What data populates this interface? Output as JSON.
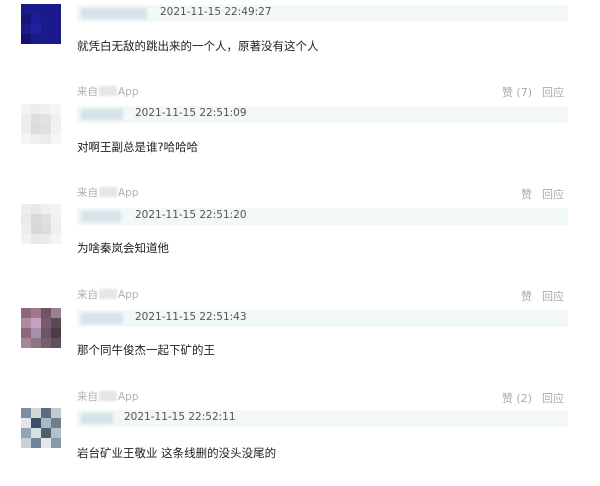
{
  "comments": [
    {
      "source_prefix": "",
      "source_suffix": "",
      "like_label": "",
      "reply_label": "",
      "timestamp": "2021-11-15 22:49:27",
      "text": "就凭白无敌的跳出来的一个人，原著没有这个人",
      "avatar_colors": [
        "#1a1a8c",
        "#1a1a8c",
        "#1a1a8c",
        "#1a1a8c",
        "#15157a",
        "#1c1c95",
        "#1a1a8c",
        "#1a1a8c",
        "#1a1a8c",
        "#2020a0",
        "#1a1a8c",
        "#1a1a8c",
        "#12126e",
        "#1a1a8c",
        "#1a1a8c",
        "#1a1a8c"
      ]
    },
    {
      "source_prefix": "来自",
      "source_suffix": "App",
      "like_label": "赞 (7)",
      "reply_label": "回应",
      "timestamp": "2021-11-15 22:51:09",
      "text": "对啊王副总是谁?哈哈哈",
      "avatar_colors": [
        "#f3f3f3",
        "#eeeeee",
        "#f0f0f0",
        "#f5f5f5",
        "#ececec",
        "#dedede",
        "#e2e2e2",
        "#f0f0f0",
        "#eeeeee",
        "#dcdcdc",
        "#e0e0e0",
        "#f1f1f1",
        "#f5f5f5",
        "#efefef",
        "#ececec",
        "#f6f6f6"
      ]
    },
    {
      "source_prefix": "来自",
      "source_suffix": "App",
      "like_label": "赞",
      "reply_label": "回应",
      "timestamp": "2021-11-15 22:51:20",
      "text": "为啥秦岚会知道他",
      "avatar_colors": [
        "#eeeeee",
        "#e8e8e8",
        "#f0f0f0",
        "#f3f3f3",
        "#e9e9e9",
        "#dadada",
        "#e0e0e0",
        "#f0f0f0",
        "#eeeeee",
        "#d8d8d8",
        "#dddddd",
        "#efefef",
        "#f2f2f2",
        "#e7e7e7",
        "#ebebeb",
        "#f4f4f4"
      ]
    },
    {
      "source_prefix": "来自",
      "source_suffix": "App",
      "like_label": "赞",
      "reply_label": "回应",
      "timestamp": "2021-11-15 22:51:43",
      "text": "那个同牛俊杰一起下矿的王",
      "avatar_colors": [
        "#8a6a7a",
        "#a07a8a",
        "#6c5464",
        "#9b8090",
        "#b08aa0",
        "#c8a0c0",
        "#7a5a70",
        "#5c4a52",
        "#8a6878",
        "#a890a8",
        "#6e5464",
        "#4c3c44",
        "#a48898",
        "#8e7484",
        "#746070",
        "#605058"
      ]
    },
    {
      "source_prefix": "来自",
      "source_suffix": "App",
      "like_label": "赞 (2)",
      "reply_label": "回应",
      "timestamp": "2021-11-15 22:52:11",
      "text": "岩台矿业王敬业 这条线删的没头没尾的",
      "avatar_colors": [
        "#7c8ea0",
        "#d0d8dc",
        "#5a6e80",
        "#c0ccd4",
        "#e0e6ea",
        "#3e5064",
        "#a8b8c4",
        "#6c8090",
        "#90a4b4",
        "#d8e0e4",
        "#4c6070",
        "#b4c0c8",
        "#c8d0d8",
        "#708498",
        "#e4e8ec",
        "#8898a8"
      ]
    }
  ]
}
